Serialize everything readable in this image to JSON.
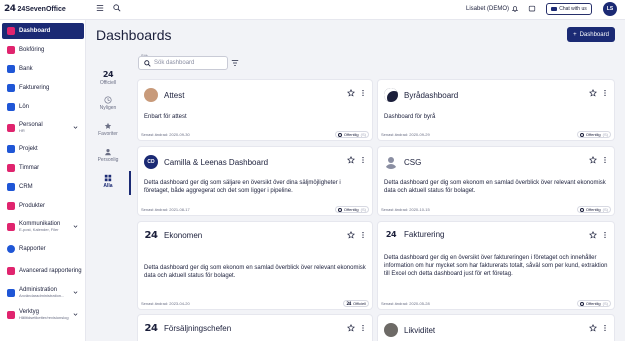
{
  "topbar": {
    "logo_mark": "24",
    "logo_text": "24SevenOffice",
    "user_name": "Lisabet (DEMO)",
    "chat_label": "Chat with us",
    "avatar_initials": "LS"
  },
  "sidebar": {
    "items": [
      {
        "label": "Dashboard",
        "sub": "",
        "color": "#e0246e"
      },
      {
        "label": "Bokföring",
        "sub": "",
        "color": "#e0246e"
      },
      {
        "label": "Bank",
        "sub": "",
        "color": "#1f56d6"
      },
      {
        "label": "Fakturering",
        "sub": "",
        "color": "#1f56d6"
      },
      {
        "label": "Lön",
        "sub": "",
        "color": "#1f56d6"
      },
      {
        "label": "Personal",
        "sub": "HR",
        "color": "#e0246e"
      },
      {
        "label": "Projekt",
        "sub": "",
        "color": "#1f56d6"
      },
      {
        "label": "Timmar",
        "sub": "",
        "color": "#e0246e"
      },
      {
        "label": "CRM",
        "sub": "",
        "color": "#1f56d6"
      },
      {
        "label": "Produkter",
        "sub": "",
        "color": "#e0246e"
      },
      {
        "label": "Kommunikation",
        "sub": "E-post, Kalender, Filer",
        "color": "#e0246e"
      },
      {
        "label": "Rapporter",
        "sub": "",
        "color": "#1f56d6"
      },
      {
        "label": "Avancerad rapportering",
        "sub": "",
        "color": "#e0246e"
      },
      {
        "label": "Administration",
        "sub": "Användaradministration...",
        "color": "#1f56d6"
      },
      {
        "label": "Verktyg",
        "sub": "Hålltidsetiketter/revisionslog",
        "color": "#e0246e"
      }
    ]
  },
  "filters": [
    {
      "label": "Officiell"
    },
    {
      "label": "Nyligen"
    },
    {
      "label": "Favoriter"
    },
    {
      "label": "Personlig"
    },
    {
      "label": "Alla"
    }
  ],
  "header": {
    "title": "Dashboards",
    "new_button": "Dashboard",
    "search_label": "Sök",
    "search_placeholder": "Sök dashboard"
  },
  "cards": [
    {
      "title": "Attest",
      "avatar": "",
      "desc": "Enbart för attest",
      "date": "Senast ändrad: 2020-09-30",
      "badge": "Offentlig",
      "badge_extra": "(S)"
    },
    {
      "title": "Byrådashboard",
      "avatar": "",
      "desc": "Dashboard för byrå",
      "date": "Senast ändrad: 2020-09-29",
      "badge": "Offentlig",
      "badge_extra": "(S)"
    },
    {
      "title": "Camilla & Leenas Dashboard",
      "avatar": "CD",
      "desc": "Detta dashboard ger dig som säljare en översikt över dina säljmöjligheter i företaget, både aggregerat och det som ligger i pipeline.",
      "date": "Senast ändrad: 2021-08-17",
      "badge": "Offentlig",
      "badge_extra": "(S)"
    },
    {
      "title": "CSG",
      "avatar": "",
      "desc": "Detta dashboard ger dig som ekonom en samlad överblick över relevant ekonomisk data och aktuell status för bolaget.",
      "date": "Senast ändrad: 2020-10-15",
      "badge": "Offentlig",
      "badge_extra": "(S)"
    },
    {
      "title": "Ekonomen",
      "avatar": "24",
      "desc": "Detta dashboard ger dig som ekonom en samlad överblick över relevant ekonomisk data och aktuell status för bolaget.",
      "date": "Senast ändrad: 2023-04-20",
      "badge": "Officiell",
      "badge_extra": ""
    },
    {
      "title": "Fakturering",
      "avatar": "24",
      "desc": "Detta dashboard ger dig en översikt över faktureringen i företaget och innehåller information om hur mycket som har fakturerats totalt, såväl som per kund, extraktion till Excel och detta dashboard just för ert företag.",
      "date": "Senast ändrad: 2020-05-28",
      "badge": "Offentlig",
      "badge_extra": "(S)"
    },
    {
      "title": "Försäljningschefen",
      "avatar": "24",
      "desc": "",
      "date": "",
      "badge": "",
      "badge_extra": ""
    },
    {
      "title": "Likviditet",
      "avatar": "",
      "desc": "",
      "date": "",
      "badge": "",
      "badge_extra": ""
    }
  ]
}
